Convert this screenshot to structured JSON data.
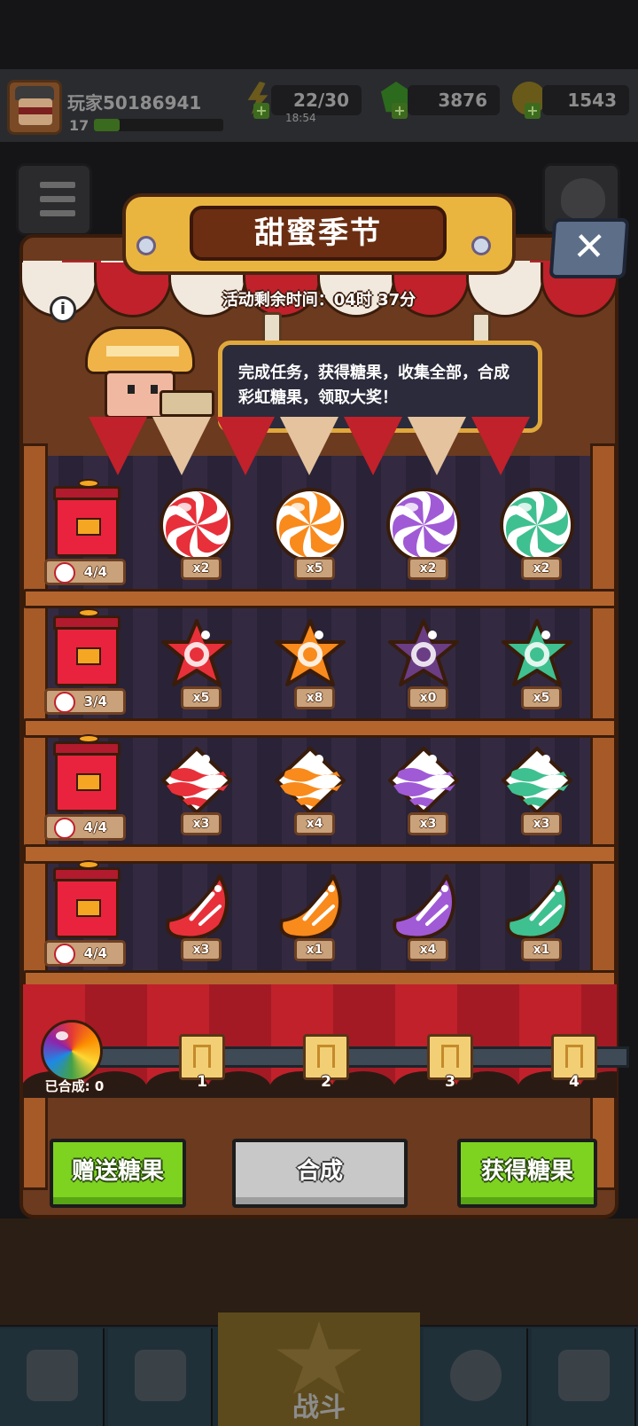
{
  "player": {
    "name": "玩家50186941",
    "level": "17",
    "xp_fraction": 0.2
  },
  "resources": {
    "energy": {
      "value": "22/30",
      "timer": "18:54",
      "icon": "lightning-icon"
    },
    "gems": {
      "value": "3876",
      "icon": "green-gem-icon"
    },
    "coins": {
      "value": "1543",
      "icon": "gold-coin-icon"
    }
  },
  "event": {
    "title": "甜蜜季节",
    "timer_text": "活动剩余时间：04时 37分",
    "info_label": "i",
    "close_label": "✕",
    "message": "完成任务，获得糖果，收集全部，合成彩虹糖果，领取大奖！"
  },
  "shelves": [
    {
      "shape": "swirl",
      "progress": "4/4",
      "candies": [
        {
          "color": "#e8303a",
          "qty": "x2"
        },
        {
          "color": "#f98a1c",
          "qty": "x5"
        },
        {
          "color": "#a05ad6",
          "qty": "x2"
        },
        {
          "color": "#3fc090",
          "qty": "x2"
        }
      ]
    },
    {
      "shape": "star",
      "progress": "3/4",
      "candies": [
        {
          "color": "#e8303a",
          "qty": "x5"
        },
        {
          "color": "#f98a1c",
          "qty": "x8"
        },
        {
          "color": "#6b3d85",
          "qty": "x0"
        },
        {
          "color": "#3fc090",
          "qty": "x5"
        }
      ]
    },
    {
      "shape": "wave",
      "progress": "4/4",
      "candies": [
        {
          "color": "#e8303a",
          "qty": "x3"
        },
        {
          "color": "#f98a1c",
          "qty": "x4"
        },
        {
          "color": "#a05ad6",
          "qty": "x3"
        },
        {
          "color": "#3fc090",
          "qty": "x3"
        }
      ]
    },
    {
      "shape": "drop",
      "progress": "4/4",
      "candies": [
        {
          "color": "#e8303a",
          "qty": "x3"
        },
        {
          "color": "#f98a1c",
          "qty": "x1"
        },
        {
          "color": "#a05ad6",
          "qty": "x4"
        },
        {
          "color": "#3fc090",
          "qty": "x1"
        }
      ]
    }
  ],
  "merge": {
    "merged_label": "已合成: 0",
    "milestones": [
      "1",
      "2",
      "3",
      "4"
    ]
  },
  "buttons": {
    "gift": "赠送糖果",
    "merge": "合成",
    "obtain": "获得糖果"
  },
  "nav": {
    "battle": "战斗"
  },
  "colors": {
    "accent_green": "#7ed321",
    "booth_red": "#c0212b",
    "title_gold": "#e9b53f"
  }
}
